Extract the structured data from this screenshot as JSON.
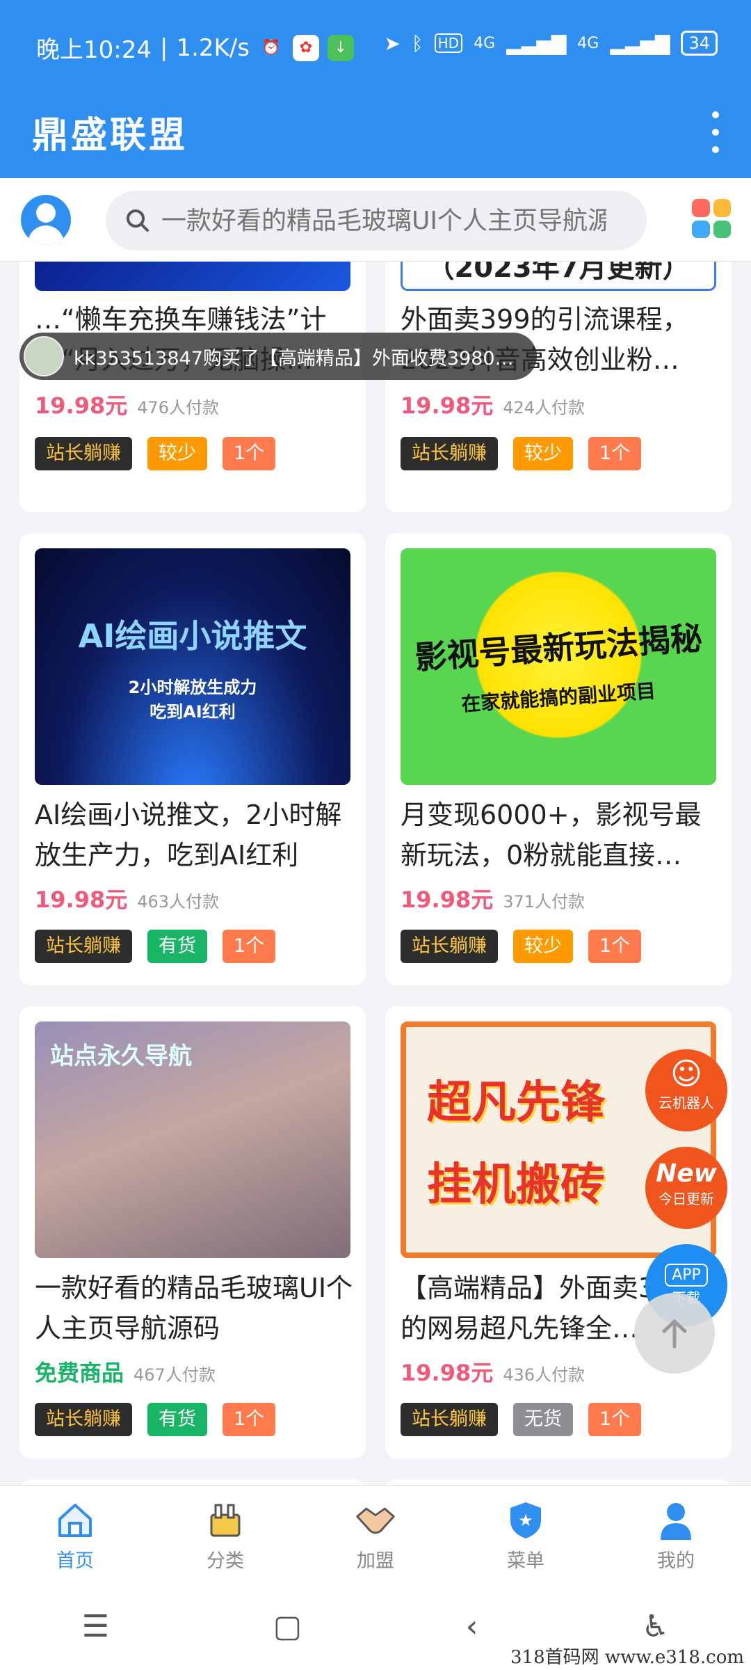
{
  "status": {
    "time": "晚上10:24",
    "speed": "1.2K/s",
    "net1": "4G",
    "net2": "4G",
    "hd": "HD",
    "battery": "34"
  },
  "app": {
    "title": "鼎盛联盟"
  },
  "search": {
    "placeholder": "一款好看的精品毛玻璃UI个人主页导航源码"
  },
  "toast": {
    "text": "kk353513847购买了【高端精品】外面收费3980的…"
  },
  "products": [
    {
      "title": "…“懒车充换车赚钱法”计划“月入过万，无脑操…",
      "thumb_text": "",
      "price": "19.98元",
      "paid": "476人付款",
      "tags": [
        "站长躺赚",
        "较少",
        "1个"
      ]
    },
    {
      "title": "外面卖399的引流课程，2023抖音高效创业粉…",
      "thumb_text": "（2023年7月更新）",
      "price": "19.98元",
      "paid": "424人付款",
      "tags": [
        "站长躺赚",
        "较少",
        "1个"
      ]
    },
    {
      "title": "AI绘画小说推文，2小时解放生产力，吃到AI红利",
      "thumb_text": "AI绘画小说推文",
      "thumb_sub": "2小时解放生成力\n吃到AI红利",
      "price": "19.98元",
      "paid": "463人付款",
      "tags": [
        "站长躺赚",
        "有货",
        "1个"
      ]
    },
    {
      "title": "月变现6000+，影视号最新玩法，0粉就能直接…",
      "thumb_text": "影视号最新玩法揭秘",
      "thumb_sub": "在家就能搞的副业项目",
      "price": "19.98元",
      "paid": "371人付款",
      "tags": [
        "站长躺赚",
        "较少",
        "1个"
      ]
    },
    {
      "title": "一款好看的精品毛玻璃UI个人主页导航源码",
      "thumb_text": "站点永久导航",
      "price": "免费商品",
      "paid": "467人付款",
      "tags": [
        "站长躺赚",
        "有货",
        "1个"
      ]
    },
    {
      "title": "【高端精品】外面卖3980的网易超凡先锋全…",
      "thumb_text": "超凡先锋",
      "thumb_sub": "挂机搬砖",
      "price": "19.98元",
      "paid": "436人付款",
      "tags": [
        "站长躺赚",
        "无货",
        "1个"
      ]
    }
  ],
  "floating": {
    "robot": "云机器人",
    "new": "New",
    "today": "今日更新",
    "app": "APP",
    "download": "下载"
  },
  "nav": [
    {
      "label": "首页"
    },
    {
      "label": "分类"
    },
    {
      "label": "加盟"
    },
    {
      "label": "菜单"
    },
    {
      "label": "我的"
    }
  ],
  "watermark": "318首码网  www.e318.com",
  "colors": {
    "primary": "#2f8ff0",
    "price": "#ef5a7b",
    "free": "#18b566"
  }
}
